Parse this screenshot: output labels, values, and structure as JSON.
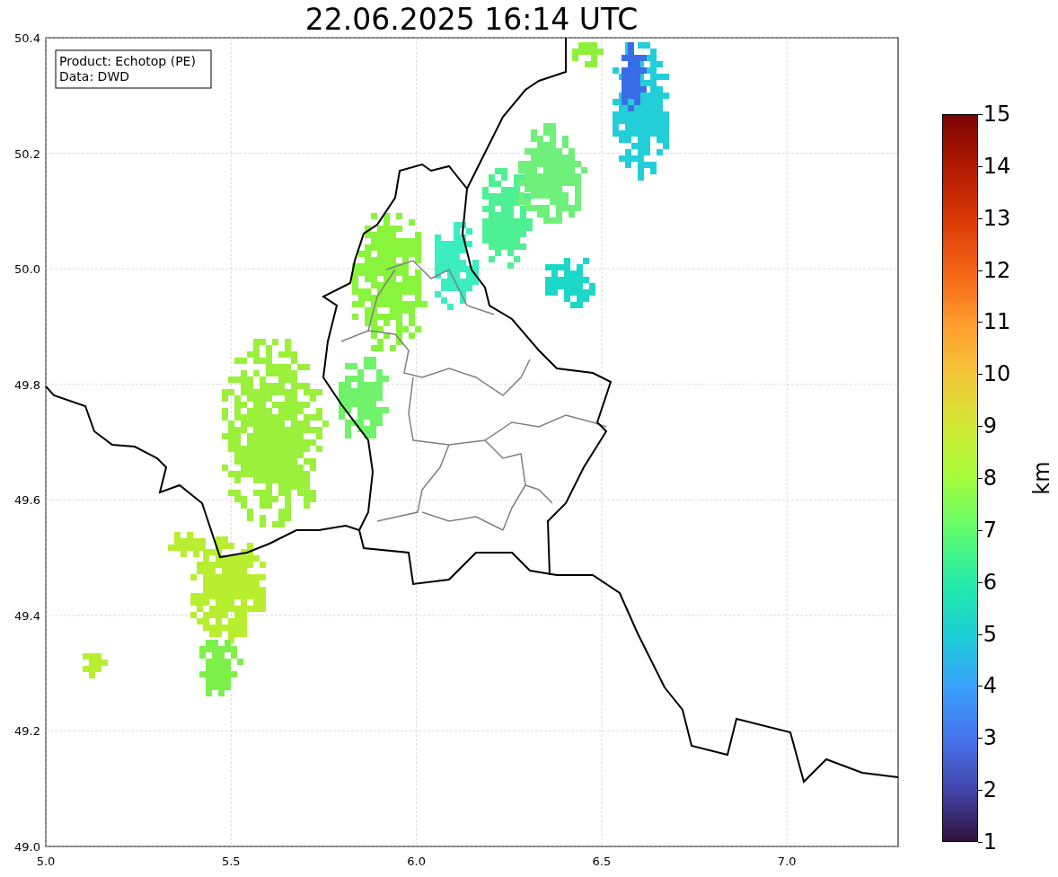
{
  "title": "22.06.2025 16:14 UTC",
  "legend": {
    "lines": [
      "Product: Echotop (PE)",
      "Data: DWD"
    ]
  },
  "x_axis": {
    "ticks": [
      "5.0",
      "5.5",
      "6.0",
      "6.5",
      "7.0"
    ]
  },
  "y_axis": {
    "ticks": [
      "50.4",
      "50.2",
      "50.0",
      "49.8",
      "49.6",
      "49.4",
      "49.2",
      "49.0"
    ]
  },
  "colorbar": {
    "label": "km",
    "ticks": [
      "15",
      "14",
      "13",
      "12",
      "11",
      "10",
      "9",
      "8",
      "7",
      "6",
      "5",
      "4",
      "3",
      "2",
      "1"
    ]
  }
}
